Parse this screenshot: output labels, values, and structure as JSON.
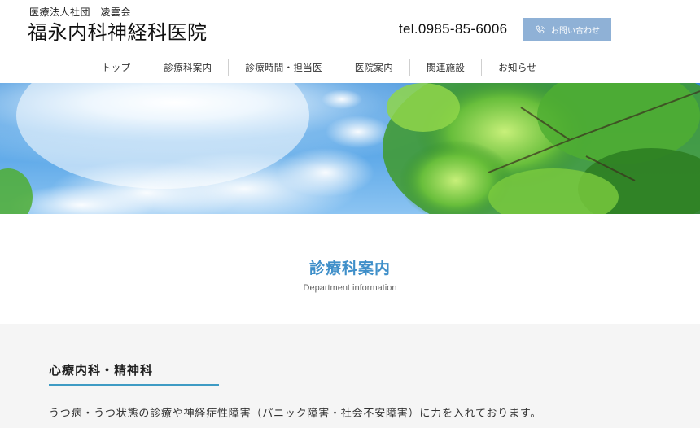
{
  "header": {
    "organization": "医療法人社団　凌雲会",
    "clinic_name": "福永内科神経科医院",
    "tel": "tel.0985-85-6006",
    "contact_label": "お問い合わせ",
    "contact_icon": "phone-icon"
  },
  "nav": {
    "items": [
      {
        "label": "トップ"
      },
      {
        "label": "診療科案内"
      },
      {
        "label": "診療時間・担当医"
      },
      {
        "label": "医院案内"
      },
      {
        "label": "関連施設"
      },
      {
        "label": "お知らせ"
      }
    ]
  },
  "hero": {
    "image": "blue-sky-with-green-leaves"
  },
  "page": {
    "title": "診療科案内",
    "subtitle": "Department information"
  },
  "section": {
    "heading": "心療内科・精神科",
    "text": "うつ病・うつ状態の診療や神経症性障害（パニック障害・社会不安障害）に力を入れております。"
  },
  "colors": {
    "accent_blue": "#3f8fc9",
    "button_blue": "#8fb1d6",
    "underline": "#3e9bc4",
    "content_bg": "#f5f5f5"
  }
}
